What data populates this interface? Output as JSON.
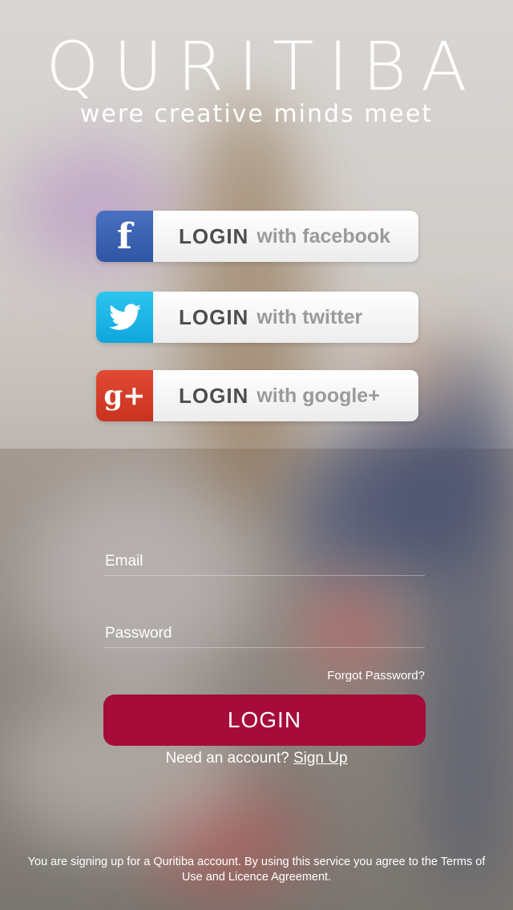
{
  "brand": {
    "title": "QURITIBA",
    "tagline": "were creative minds meet"
  },
  "social": {
    "facebook": {
      "login": "LOGIN",
      "with": "with facebook",
      "icon": "facebook-icon",
      "color": "#3b5fb0"
    },
    "twitter": {
      "login": "LOGIN",
      "with": "with twitter",
      "icon": "twitter-bird-icon",
      "color": "#1db3e6"
    },
    "google": {
      "login": "LOGIN",
      "with": "with google+",
      "icon": "google-plus-icon",
      "color": "#d63b27"
    }
  },
  "form": {
    "email_placeholder": "Email",
    "password_placeholder": "Password",
    "forgot": "Forgot Password?",
    "login_button": "LOGIN",
    "need_account": "Need an account?",
    "sign_up": "Sign Up"
  },
  "footer": {
    "text": "You are signing up for a Quritiba account. By using this service you agree to the Terms of Use and Licence Agreement."
  },
  "colors": {
    "accent": "#a60b3a"
  }
}
